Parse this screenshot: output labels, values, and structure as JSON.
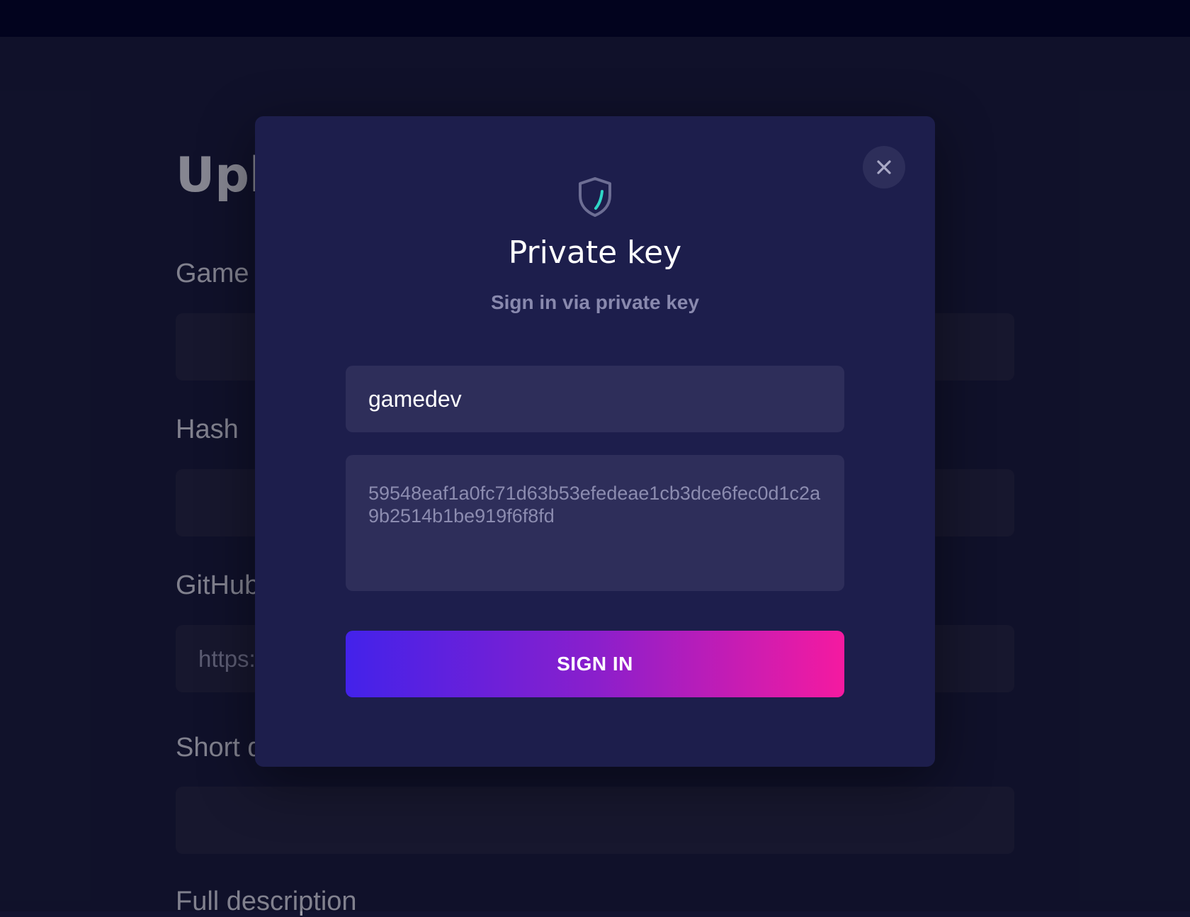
{
  "background_form": {
    "title": "Upload application",
    "fields": [
      {
        "label": "Game name",
        "value": ""
      },
      {
        "label": "Hash",
        "value": ""
      },
      {
        "label": "GitHub repository",
        "value": "https://"
      },
      {
        "label": "Short description",
        "value": ""
      },
      {
        "label": "Full description"
      }
    ]
  },
  "modal": {
    "icon": "shield-icon",
    "title": "Private key",
    "subtitle": "Sign in via private key",
    "username_value": "gamedev",
    "private_key_value": "59548eaf1a0fc71d63b53efedeae1cb3dce6fec0d1c2a9b2514b1be919f6f8fd",
    "submit_label": "SIGN IN",
    "close_icon": "close-icon"
  },
  "colors": {
    "modal_bg": "#1d1e4c",
    "input_bg": "#2e2e5a",
    "button_gradient_start": "#4322ea",
    "button_gradient_end": "#f51aa0",
    "accent_teal": "#2fd6c6"
  }
}
